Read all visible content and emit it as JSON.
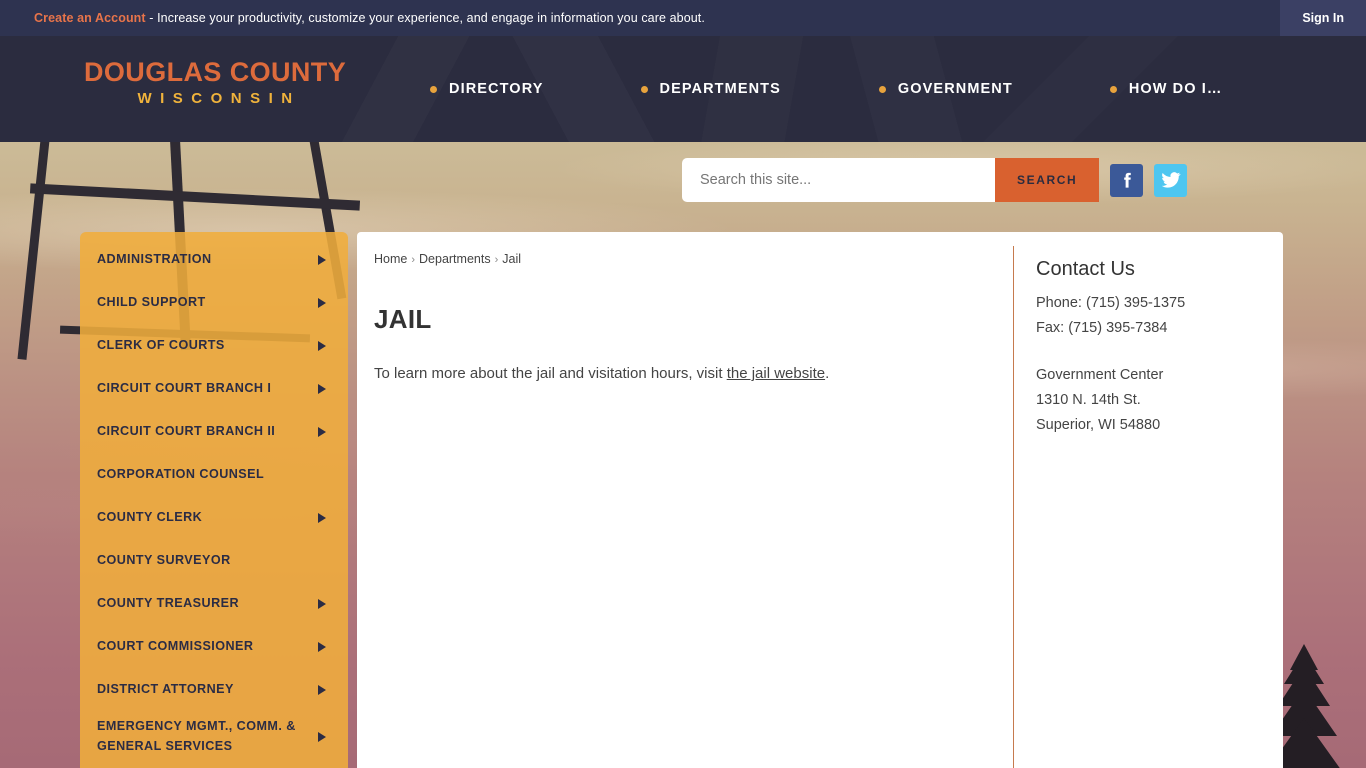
{
  "topbar": {
    "account_link": "Create an Account",
    "message": " - Increase your productivity, customize your experience, and engage in information you care about.",
    "signin": "Sign In"
  },
  "header": {
    "logo_main": "DOUGLAS COUNTY",
    "logo_sub": "WISCONSIN",
    "nav": [
      {
        "label": "DIRECTORY"
      },
      {
        "label": "DEPARTMENTS"
      },
      {
        "label": "GOVERNMENT"
      },
      {
        "label": "HOW DO I…"
      }
    ]
  },
  "search": {
    "placeholder": "Search this site...",
    "value": "",
    "button": "SEARCH",
    "facebook_icon": "facebook-icon",
    "twitter_icon": "twitter-icon"
  },
  "sidebar": {
    "items": [
      {
        "label": "ADMINISTRATION",
        "has_arrow": true
      },
      {
        "label": "CHILD SUPPORT",
        "has_arrow": true
      },
      {
        "label": "CLERK OF COURTS",
        "has_arrow": true
      },
      {
        "label": "CIRCUIT COURT BRANCH I",
        "has_arrow": true
      },
      {
        "label": "CIRCUIT COURT BRANCH II",
        "has_arrow": true
      },
      {
        "label": "CORPORATION COUNSEL",
        "has_arrow": false
      },
      {
        "label": "COUNTY CLERK",
        "has_arrow": true
      },
      {
        "label": "COUNTY SURVEYOR",
        "has_arrow": false
      },
      {
        "label": "COUNTY TREASURER",
        "has_arrow": true
      },
      {
        "label": "COURT COMMISSIONER",
        "has_arrow": true
      },
      {
        "label": "DISTRICT ATTORNEY",
        "has_arrow": true
      },
      {
        "label": "EMERGENCY MGMT., COMM. & GENERAL SERVICES",
        "has_arrow": true
      }
    ]
  },
  "main": {
    "breadcrumb": {
      "home": "Home",
      "sep1": "›",
      "departments": "Departments",
      "sep2": "›",
      "current": "Jail"
    },
    "title": "JAIL",
    "body_prefix": "To learn more about the jail and visitation hours, visit ",
    "body_link": "the jail website",
    "body_suffix": "."
  },
  "contact": {
    "title": "Contact Us",
    "phone": "Phone: (715) 395-1375",
    "fax": "Fax: (715) 395-7384",
    "address_line1": "Government Center",
    "address_line2": "1310 N. 14th St.",
    "address_line3": "Superior, WI 54880"
  },
  "colors": {
    "topbar_bg": "#2e3350",
    "header_bg": "#2b2c3f",
    "accent_orange": "#d9612f",
    "logo_orange": "#dd6b3c",
    "logo_gold": "#f0b33c",
    "sidebar_amber": "#f0ad3c",
    "nav_dot": "#e8a33d",
    "facebook_blue": "#3b5998",
    "twitter_blue": "#4ec6f0",
    "contact_border": "#c67a4e"
  }
}
